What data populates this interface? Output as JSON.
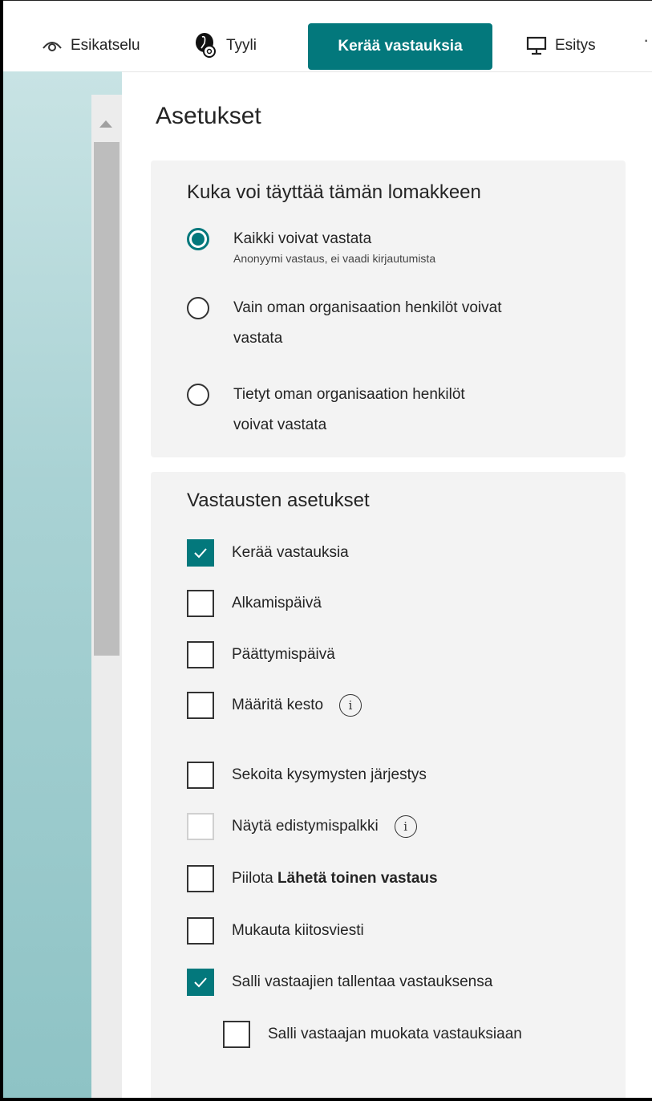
{
  "toolbar": {
    "preview_label": "Esikatselu",
    "style_label": "Tyyli",
    "collect_label": "Kerää vastauksia",
    "present_label": "Esitys",
    "more_label": "··"
  },
  "settings": {
    "title": "Asetukset",
    "who_can_fill": {
      "title": "Kuka voi täyttää tämän lomakkeen",
      "options": [
        {
          "label": "Kaikki voivat vastata",
          "sub": "Anonyymi vastaus, ei vaadi kirjautumista",
          "selected": true
        },
        {
          "label_line1": "Vain oman organisaation henkilöt voivat",
          "label_line2": "vastata",
          "selected": false
        },
        {
          "label_line1": "Tietyt oman organisaation henkilöt",
          "label_line2": "voivat vastata",
          "selected": false
        }
      ]
    },
    "response_settings": {
      "title": "Vastausten asetukset",
      "items": [
        {
          "label": "Kerää vastauksia",
          "checked": true
        },
        {
          "label": "Alkamispäivä",
          "checked": false
        },
        {
          "label": "Päättymispäivä",
          "checked": false
        },
        {
          "label": "Määritä kesto",
          "checked": false,
          "info": "i"
        },
        {
          "label": "Sekoita kysymysten järjestys",
          "checked": false
        },
        {
          "label": "Näytä edistymispalkki",
          "checked": false,
          "disabled": true,
          "info": "i"
        },
        {
          "label_prefix": "Piilota ",
          "label_bold": "Lähetä toinen vastaus",
          "checked": false
        },
        {
          "label": "Mukauta kiitosviesti",
          "checked": false
        },
        {
          "label": "Salli vastaajien tallentaa vastauksensa",
          "checked": true
        },
        {
          "label": "Salli vastaajan muokata vastauksiaan",
          "checked": false
        }
      ]
    }
  },
  "colors": {
    "accent": "#03787c"
  }
}
